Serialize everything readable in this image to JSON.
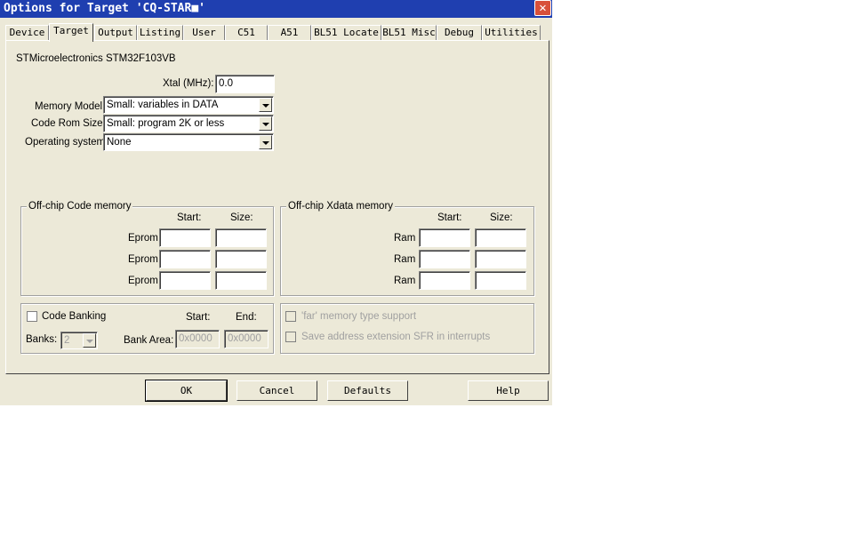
{
  "window": {
    "title": "Options for Target 'CQ-STAR■'",
    "close_glyph": "✕"
  },
  "tabs": [
    {
      "label": "Device"
    },
    {
      "label": "Target"
    },
    {
      "label": "Output"
    },
    {
      "label": "Listing"
    },
    {
      "label": "User"
    },
    {
      "label": "C51"
    },
    {
      "label": "A51"
    },
    {
      "label": "BL51 Locate"
    },
    {
      "label": "BL51 Misc"
    },
    {
      "label": "Debug"
    },
    {
      "label": "Utilities"
    }
  ],
  "active_tab": "Target",
  "device_name": "STMicroelectronics STM32F103VB",
  "xtal": {
    "label": "Xtal (MHz):",
    "value": "0.0"
  },
  "memory_model": {
    "label": "Memory Model:",
    "value": "Small: variables in DATA"
  },
  "code_rom_size": {
    "label": "Code Rom Size:",
    "value": "Small: program 2K or less"
  },
  "operating_system": {
    "label": "Operating system:",
    "value": "None"
  },
  "offchip_code": {
    "title": "Off-chip Code memory",
    "start_header": "Start:",
    "size_header": "Size:",
    "rows": [
      {
        "label": "Eprom"
      },
      {
        "label": "Eprom"
      },
      {
        "label": "Eprom"
      }
    ]
  },
  "offchip_xdata": {
    "title": "Off-chip Xdata memory",
    "start_header": "Start:",
    "size_header": "Size:",
    "rows": [
      {
        "label": "Ram"
      },
      {
        "label": "Ram"
      },
      {
        "label": "Ram"
      }
    ]
  },
  "banking": {
    "code_banking_label": "Code Banking",
    "banks_label": "Banks:",
    "banks_value": "2",
    "bank_area_label": "Bank Area:",
    "start_header": "Start:",
    "end_header": "End:",
    "start_value": "0x0000",
    "end_value": "0x0000"
  },
  "options": {
    "far_memory_label": "'far' memory type support",
    "save_address_label": "Save address extension SFR in interrupts"
  },
  "buttons": {
    "ok": "OK",
    "cancel": "Cancel",
    "defaults": "Defaults",
    "help": "Help"
  }
}
